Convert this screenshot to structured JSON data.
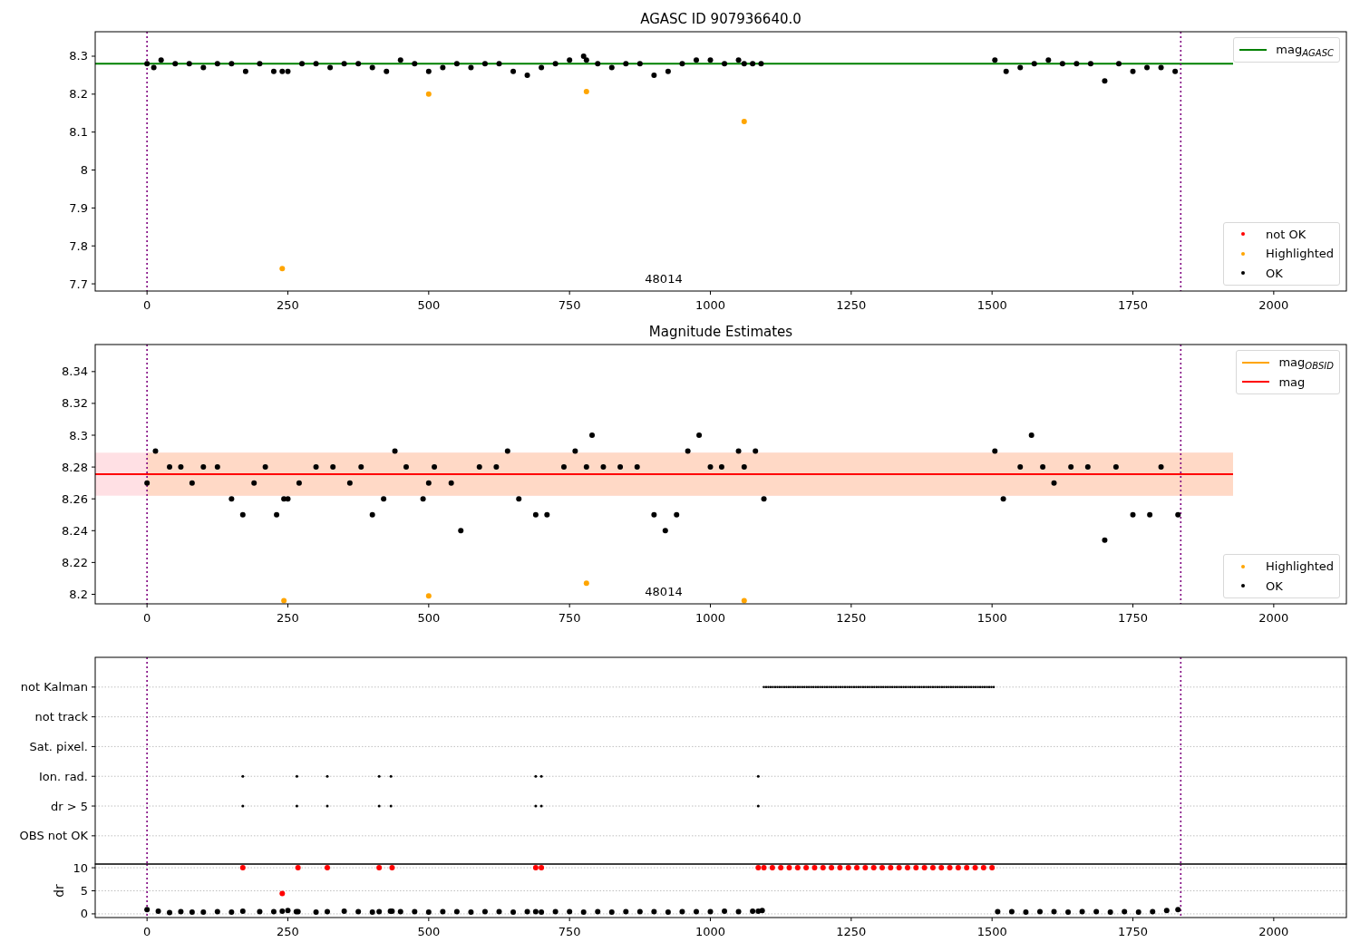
{
  "figure": {
    "panels": [
      {
        "chart_data": {
          "type": "scatter",
          "title": "AGASC ID 907936640.0",
          "xlim": [
            -92,
            2129
          ],
          "ylim": [
            7.681,
            8.3645
          ],
          "xticks": [
            0,
            250,
            500,
            750,
            1000,
            1250,
            1500,
            1750,
            2000
          ],
          "yticks": [
            7.7,
            7.8,
            7.9,
            8.0,
            8.1,
            8.2,
            8.3
          ],
          "x": [
            0,
            12,
            25,
            50,
            75,
            100,
            125,
            150,
            175,
            200,
            225,
            240,
            250,
            275,
            300,
            325,
            350,
            375,
            400,
            425,
            450,
            475,
            500,
            525,
            550,
            575,
            600,
            625,
            650,
            675,
            700,
            725,
            750,
            775,
            780,
            800,
            825,
            850,
            875,
            900,
            925,
            950,
            975,
            1000,
            1025,
            1050,
            1060,
            1075,
            1090,
            1505,
            1525,
            1550,
            1575,
            1600,
            1625,
            1650,
            1675,
            1700,
            1725,
            1750,
            1775,
            1800,
            1825
          ],
          "series": [
            {
              "color": "#ffa500",
              "values": [
                null,
                null,
                null,
                null,
                null,
                null,
                null,
                null,
                null,
                null,
                null,
                7.74,
                null,
                null,
                null,
                null,
                null,
                null,
                null,
                null,
                null,
                null,
                8.2,
                null,
                null,
                null,
                null,
                null,
                null,
                null,
                null,
                null,
                null,
                null,
                8.207,
                null,
                null,
                null,
                null,
                null,
                null,
                null,
                null,
                null,
                null,
                null,
                8.128,
                null,
                null,
                null,
                null,
                null,
                null,
                null,
                null,
                null,
                null,
                null,
                null,
                null,
                null,
                null,
                null
              ]
            },
            {
              "color": "#000000",
              "values": [
                8.28,
                8.27,
                8.29,
                8.28,
                8.28,
                8.27,
                8.28,
                8.28,
                8.26,
                8.28,
                8.26,
                8.26,
                8.26,
                8.28,
                8.28,
                8.27,
                8.28,
                8.28,
                8.27,
                8.26,
                8.29,
                8.28,
                8.26,
                8.27,
                8.28,
                8.27,
                8.28,
                8.28,
                8.26,
                8.25,
                8.27,
                8.28,
                8.29,
                8.3,
                8.29,
                8.28,
                8.27,
                8.28,
                8.28,
                8.25,
                8.26,
                8.28,
                8.29,
                8.29,
                8.28,
                8.29,
                8.28,
                8.28,
                8.28,
                8.29,
                8.26,
                8.27,
                8.28,
                8.29,
                8.28,
                8.28,
                8.28,
                8.235,
                8.28,
                8.26,
                8.27,
                8.27,
                8.26
              ]
            }
          ],
          "ref_lines": [
            {
              "axis": "y",
              "value": 8.28,
              "color": "#008000"
            },
            {
              "axis": "x",
              "value": 0,
              "color": "#800080"
            },
            {
              "axis": "x",
              "value": 1835,
              "color": "#800080"
            }
          ],
          "annotations": [
            "48014"
          ]
        },
        "legends": [
          {
            "entries": [
              {
                "label": "mag$_{AGASC}$",
                "kind": "line",
                "color": "#008000"
              }
            ]
          },
          {
            "entries": [
              {
                "label": "not OK",
                "kind": "dot",
                "color": "#ff0000"
              },
              {
                "label": "Highlighted",
                "kind": "dot",
                "color": "#ffa500"
              },
              {
                "label": "OK",
                "kind": "dot",
                "color": "#000000"
              }
            ]
          }
        ]
      },
      {
        "chart_data": {
          "type": "scatter",
          "title": "Magnitude Estimates",
          "xlim": [
            -92,
            2129
          ],
          "ylim": [
            8.194,
            8.357
          ],
          "xticks": [
            0,
            250,
            500,
            750,
            1000,
            1250,
            1500,
            1750,
            2000
          ],
          "yticks": [
            8.2,
            8.22,
            8.24,
            8.26,
            8.28,
            8.3,
            8.32,
            8.34
          ],
          "x": [
            0,
            15,
            40,
            60,
            80,
            100,
            125,
            150,
            170,
            190,
            210,
            230,
            243,
            250,
            270,
            300,
            330,
            360,
            380,
            400,
            420,
            440,
            460,
            490,
            500,
            510,
            540,
            557,
            590,
            620,
            640,
            660,
            690,
            710,
            740,
            760,
            780,
            790,
            810,
            840,
            870,
            900,
            920,
            940,
            960,
            980,
            1000,
            1020,
            1050,
            1060,
            1080,
            1095,
            1505,
            1520,
            1550,
            1570,
            1590,
            1610,
            1640,
            1670,
            1700,
            1720,
            1750,
            1780,
            1800,
            1830
          ],
          "series": [
            {
              "color": "#ffa500",
              "values": [
                null,
                null,
                null,
                null,
                null,
                null,
                null,
                null,
                null,
                null,
                null,
                null,
                8.196,
                null,
                null,
                null,
                null,
                null,
                null,
                null,
                null,
                null,
                null,
                null,
                8.199,
                null,
                null,
                null,
                null,
                null,
                null,
                null,
                null,
                null,
                null,
                null,
                8.207,
                null,
                null,
                null,
                null,
                null,
                null,
                null,
                null,
                null,
                null,
                null,
                null,
                8.196,
                null,
                null,
                null,
                null,
                null,
                null,
                null,
                null,
                null,
                null,
                null,
                null,
                null,
                null,
                null,
                null
              ]
            },
            {
              "color": "#000000",
              "values": [
                8.27,
                8.29,
                8.28,
                8.28,
                8.27,
                8.28,
                8.28,
                8.26,
                8.25,
                8.27,
                8.28,
                8.25,
                8.26,
                8.26,
                8.27,
                8.28,
                8.28,
                8.27,
                8.28,
                8.25,
                8.26,
                8.29,
                8.28,
                8.26,
                8.27,
                8.28,
                8.27,
                8.24,
                8.28,
                8.28,
                8.29,
                8.26,
                8.25,
                8.25,
                8.28,
                8.29,
                8.28,
                8.3,
                8.28,
                8.28,
                8.28,
                8.25,
                8.24,
                8.25,
                8.29,
                8.3,
                8.28,
                8.28,
                8.29,
                8.28,
                8.29,
                8.26,
                8.29,
                8.26,
                8.28,
                8.3,
                8.28,
                8.27,
                8.28,
                8.28,
                8.234,
                8.28,
                8.25,
                8.25,
                8.28,
                8.25
              ]
            }
          ],
          "bands": [
            {
              "axis": "y",
              "from": 8.262,
              "to": 8.289,
              "color": "#ffe0e4"
            },
            {
              "axis": "y",
              "from": 8.262,
              "to": 8.289,
              "color": "#ffd9c6"
            }
          ],
          "ref_lines": [
            {
              "axis": "y",
              "value": 8.2755,
              "color": "#ff0000"
            },
            {
              "axis": "x",
              "value": 0,
              "color": "#800080"
            },
            {
              "axis": "x",
              "value": 1835,
              "color": "#800080"
            }
          ],
          "annotations": [
            "48014"
          ]
        },
        "legends": [
          {
            "entries": [
              {
                "label": "mag$_{OBSID}$",
                "kind": "line",
                "color": "#ffa500"
              },
              {
                "label": "mag",
                "kind": "line",
                "color": "#ff0000"
              }
            ]
          },
          {
            "entries": [
              {
                "label": "Highlighted",
                "kind": "dot",
                "color": "#ffa500"
              },
              {
                "label": "OK",
                "kind": "dot",
                "color": "#000000"
              }
            ]
          }
        ]
      },
      {
        "flag_rows": [
          {
            "label": "not Kalman"
          },
          {
            "label": "not track"
          },
          {
            "label": "Sat. pixel."
          },
          {
            "label": "Ion. rad."
          },
          {
            "label": "dr > 5"
          },
          {
            "label": "OBS not OK"
          }
        ]
      },
      {
        "chart_data": {
          "type": "scatter",
          "grid": true,
          "ylabel": "dr",
          "xlim": [
            -92,
            2129
          ],
          "ylim": [
            -0.8,
            10.8
          ],
          "xticks": [
            0,
            250,
            500,
            750,
            1000,
            1250,
            1500,
            1750,
            2000
          ],
          "yticks": [
            0,
            5,
            10
          ],
          "x": [
            0,
            20,
            40,
            60,
            80,
            100,
            125,
            150,
            170,
            200,
            225,
            240,
            250,
            265,
            268,
            300,
            320,
            350,
            375,
            400,
            412,
            432,
            435,
            450,
            475,
            500,
            525,
            550,
            575,
            600,
            625,
            650,
            675,
            690,
            700,
            725,
            750,
            775,
            800,
            825,
            850,
            875,
            900,
            925,
            950,
            975,
            1000,
            1025,
            1050,
            1075,
            1085,
            1092,
            1095,
            1110,
            1125,
            1140,
            1155,
            1170,
            1185,
            1200,
            1215,
            1230,
            1245,
            1260,
            1275,
            1290,
            1305,
            1320,
            1335,
            1350,
            1365,
            1380,
            1395,
            1410,
            1425,
            1440,
            1455,
            1470,
            1485,
            1500,
            1510,
            1535,
            1560,
            1585,
            1610,
            1635,
            1660,
            1685,
            1710,
            1735,
            1760,
            1785,
            1810,
            1830
          ],
          "series": [
            {
              "color": "#ff0000",
              "values": [
                null,
                null,
                null,
                null,
                null,
                null,
                null,
                null,
                10,
                null,
                null,
                4.4,
                null,
                null,
                10,
                null,
                10,
                null,
                null,
                null,
                10,
                null,
                10,
                null,
                null,
                null,
                null,
                null,
                null,
                null,
                null,
                null,
                null,
                10,
                10,
                null,
                null,
                null,
                null,
                null,
                null,
                null,
                null,
                null,
                null,
                null,
                null,
                null,
                null,
                null,
                10,
                null,
                10,
                10,
                10,
                10,
                10,
                10,
                10,
                10,
                10,
                10,
                10,
                10,
                10,
                10,
                10,
                10,
                10,
                10,
                10,
                10,
                10,
                10,
                10,
                10,
                10,
                10,
                10,
                10,
                null,
                null,
                null,
                null,
                null,
                null,
                null,
                null,
                null,
                null,
                null,
                null,
                null,
                null
              ]
            },
            {
              "color": "#000000",
              "values": [
                0.9,
                0.6,
                0.3,
                0.5,
                0.4,
                0.4,
                0.5,
                0.4,
                0.6,
                0.5,
                0.5,
                0.6,
                0.7,
                0.5,
                0.5,
                0.4,
                0.5,
                0.6,
                0.5,
                0.4,
                0.5,
                0.6,
                0.6,
                0.5,
                0.5,
                0.4,
                0.5,
                0.5,
                0.4,
                0.5,
                0.5,
                0.4,
                0.5,
                0.5,
                0.4,
                0.5,
                0.5,
                0.4,
                0.5,
                0.4,
                0.5,
                0.5,
                0.5,
                0.4,
                0.5,
                0.5,
                0.5,
                0.6,
                0.5,
                0.6,
                0.6,
                0.7,
                null,
                null,
                null,
                null,
                null,
                null,
                null,
                null,
                null,
                null,
                null,
                null,
                null,
                null,
                null,
                null,
                null,
                null,
                null,
                null,
                null,
                null,
                null,
                null,
                null,
                null,
                null,
                null,
                0.5,
                0.5,
                0.4,
                0.5,
                0.5,
                0.4,
                0.5,
                0.5,
                0.4,
                0.5,
                0.4,
                0.5,
                0.7,
                0.9
              ]
            }
          ],
          "ref_lines": [
            {
              "axis": "x",
              "value": 0,
              "color": "#800080"
            },
            {
              "axis": "x",
              "value": 1835,
              "color": "#800080"
            }
          ]
        }
      }
    ]
  }
}
